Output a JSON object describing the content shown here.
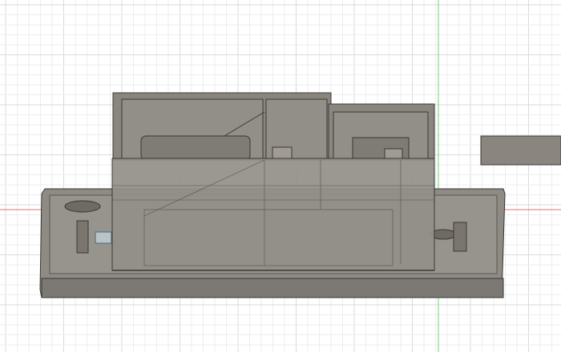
{
  "viewport": {
    "background": "#ffffff",
    "grid_minor": "#eceef0",
    "grid_major": "#d8dbde",
    "axis_x_color": "#e07070",
    "axis_y_color": "#6fd36f",
    "model_fill": "#8c8780",
    "model_dark": "#6e6a64",
    "model_edge": "#3a3835"
  }
}
